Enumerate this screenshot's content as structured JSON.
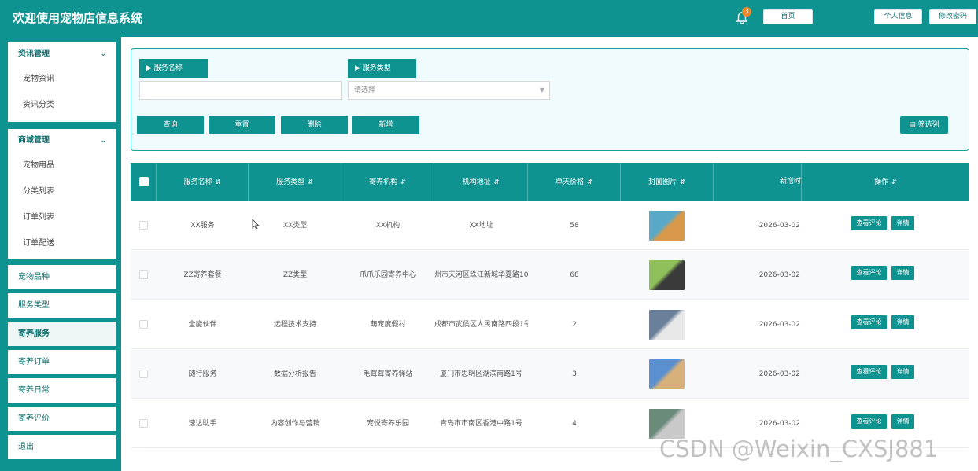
{
  "header": {
    "title": "欢迎使用宠物店信息系统",
    "notification_count": "3",
    "home_label": "首页",
    "profile_label": "个人信息",
    "change_password_label": "修改密码"
  },
  "sidebar": {
    "group_info": {
      "label": "资讯管理",
      "items": [
        "宠物资讯",
        "资讯分类"
      ]
    },
    "group_shop": {
      "label": "商城管理",
      "items": [
        "宠物用品",
        "分类列表",
        "订单列表",
        "订单配送"
      ]
    },
    "singles": [
      "宠物品种",
      "服务类型",
      "寄养服务",
      "寄养订单",
      "寄养日常",
      "寄养评价",
      "退出"
    ],
    "active": "寄养服务"
  },
  "search": {
    "service_name_label": "▶ 服务名称",
    "service_name_value": "",
    "service_type_label": "▶ 服务类型",
    "service_type_placeholder": "请选择",
    "query_label": "查询",
    "reset_label": "重置",
    "delete_label": "删除",
    "add_label": "新增",
    "filter_columns_label": "筛选列"
  },
  "table": {
    "columns": [
      "服务名称",
      "服务类型",
      "寄养机构",
      "机构地址",
      "单天价格",
      "封面图片",
      "新增时",
      "操作"
    ],
    "rows": [
      {
        "name": "XX服务",
        "type": "XX类型",
        "org": "XX机构",
        "address": "XX地址",
        "price": "58",
        "date": "2026-03-02"
      },
      {
        "name": "ZZ寄养套餐",
        "type": "ZZ类型",
        "org": "爪爪乐园寄养中心",
        "address": "州市天河区珠江新城华夏路10",
        "price": "68",
        "date": "2026-03-02"
      },
      {
        "name": "全能伙伴",
        "type": "远程技术支持",
        "org": "萌宠度假村",
        "address": "成都市武侯区人民南路四段1号",
        "price": "2",
        "date": "2026-03-02"
      },
      {
        "name": "随行服务",
        "type": "数据分析报告",
        "org": "毛茸茸寄养驿站",
        "address": "厦门市思明区湖滨南路1号",
        "price": "3",
        "date": "2026-03-02"
      },
      {
        "name": "速达助手",
        "type": "内容创作与营销",
        "org": "宠悦寄养乐园",
        "address": "青岛市市南区香港中路1号",
        "price": "4",
        "date": "2026-03-02"
      }
    ],
    "view_comments_label": "查看评论",
    "detail_label": "详情"
  },
  "watermark": "CSDN @Weixin_CXSJ881",
  "colors": {
    "primary": "#0e9391",
    "panel_bg": "#effbfc",
    "badge": "#f0882a"
  }
}
